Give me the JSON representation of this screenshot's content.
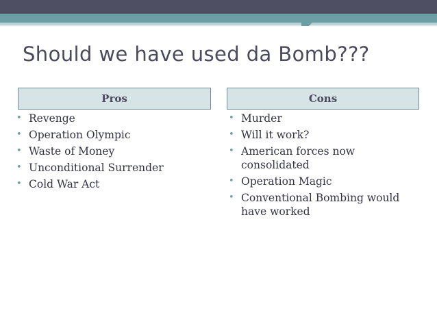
{
  "slide": {
    "title": "Should we have used da Bomb???"
  },
  "pros": {
    "header": "Pros",
    "items": [
      "Revenge",
      "Operation Olympic",
      "Waste of Money",
      "Unconditional Surrender",
      "Cold War Act"
    ]
  },
  "cons": {
    "header": "Cons",
    "items": [
      "Murder",
      "Will it work?",
      "American forces now consolidated",
      "Operation Magic",
      "Conventional Bombing would have worked"
    ]
  },
  "colors": {
    "accent": "#6c9ea6",
    "top_band": "#4e4f62",
    "header_fill": "#d6e4e7",
    "text": "#4a4a5c"
  }
}
